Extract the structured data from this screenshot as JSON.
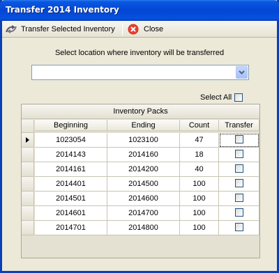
{
  "window": {
    "title": "Transfer 2014 Inventory"
  },
  "toolbar": {
    "transfer_label": "Transfer Selected Inventory",
    "close_label": "Close"
  },
  "form": {
    "prompt": "Select location where inventory will be transferred",
    "location_value": "",
    "select_all_label": "Select All",
    "select_all_checked": false
  },
  "grid": {
    "band_title": "Inventory Packs",
    "columns": [
      "Beginning",
      "Ending",
      "Count",
      "Transfer"
    ],
    "current_row": 0,
    "rows": [
      {
        "beginning": "1023054",
        "ending": "1023100",
        "count": "47",
        "transfer": false
      },
      {
        "beginning": "2014143",
        "ending": "2014160",
        "count": "18",
        "transfer": false
      },
      {
        "beginning": "2014161",
        "ending": "2014200",
        "count": "40",
        "transfer": false
      },
      {
        "beginning": "2014401",
        "ending": "2014500",
        "count": "100",
        "transfer": false
      },
      {
        "beginning": "2014501",
        "ending": "2014600",
        "count": "100",
        "transfer": false
      },
      {
        "beginning": "2014601",
        "ending": "2014700",
        "count": "100",
        "transfer": false
      },
      {
        "beginning": "2014701",
        "ending": "2014800",
        "count": "100",
        "transfer": false
      }
    ]
  }
}
